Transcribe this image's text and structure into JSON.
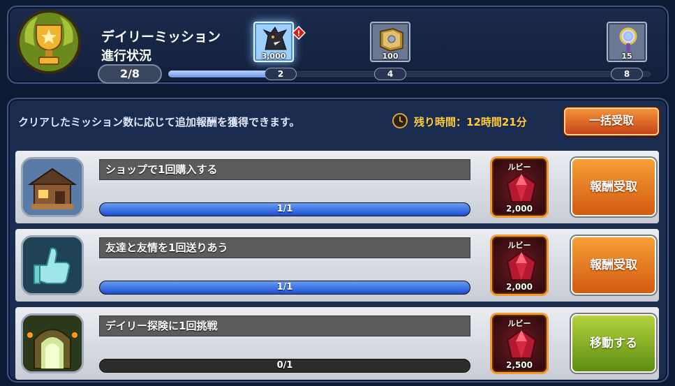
{
  "header": {
    "title": "デイリーミッション",
    "subtitle": "進行状況",
    "count": "2/8",
    "progress_fraction": 0.21
  },
  "milestones": [
    {
      "label": "2",
      "qty": "3,000",
      "icon": "monster-icon",
      "active": true,
      "alert": "!"
    },
    {
      "label": "4",
      "qty": "100",
      "icon": "book-icon",
      "active": false
    },
    {
      "label": "8",
      "qty": "15",
      "icon": "magnifier-icon",
      "active": false
    }
  ],
  "info": {
    "description": "クリアしたミッション数に応じて追加報酬を獲得できます。",
    "time_remaining": "残り時間：12時間21分",
    "claim_all_label": "一括受取"
  },
  "missions": [
    {
      "title": "ショップで1回購入する",
      "progress_text": "1/1",
      "progress_fraction": 1,
      "reward_label": "ルビー",
      "reward_amount": "2,000",
      "button_label": "報酬受取",
      "button_color": "orange",
      "icon": "shop-icon"
    },
    {
      "title": "友達と友情を1回送りあう",
      "progress_text": "1/1",
      "progress_fraction": 1,
      "reward_label": "ルビー",
      "reward_amount": "2,000",
      "button_label": "報酬受取",
      "button_color": "orange",
      "icon": "thumbs-up-icon"
    },
    {
      "title": "デイリー探険に1回挑戦",
      "progress_text": "0/1",
      "progress_fraction": 0,
      "reward_label": "ルビー",
      "reward_amount": "2,500",
      "button_label": "移動する",
      "button_color": "green",
      "icon": "dungeon-gate-icon"
    }
  ],
  "colors": {
    "accent_orange": "#e8742a",
    "accent_green": "#8bb327",
    "time_yellow": "#ffcc3a",
    "progress_blue": "#2a5fd8"
  }
}
